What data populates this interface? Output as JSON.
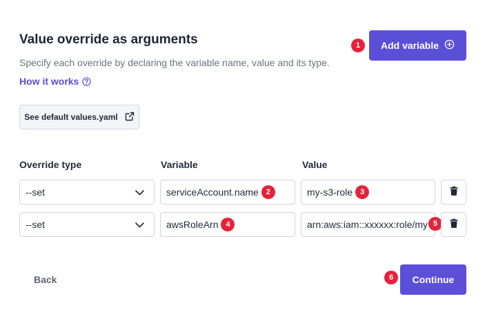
{
  "header": {
    "title": "Value override as arguments",
    "subtitle": "Specify each override by declaring the variable name, value and its type.",
    "how_it_works": "How it works"
  },
  "actions": {
    "add_variable": "Add variable",
    "see_default": "See default values.yaml",
    "back": "Back",
    "continue": "Continue"
  },
  "table": {
    "columns": [
      "Override type",
      "Variable",
      "Value"
    ],
    "rows": [
      {
        "type": "--set",
        "variable": "serviceAccount.name",
        "value": "my-s3-role"
      },
      {
        "type": "--set",
        "variable": "awsRoleArn",
        "value": "arn:aws:iam::xxxxxx:role/my"
      }
    ]
  },
  "badges": [
    "1",
    "2",
    "3",
    "4",
    "5",
    "6"
  ],
  "icons": {
    "help": "question-circle-icon",
    "add": "plus-circle-icon",
    "external": "external-link-icon",
    "chevron": "chevron-down-icon",
    "delete": "trash-icon"
  },
  "colors": {
    "primary": "#5b4fd8",
    "link": "#5a4bd1",
    "badge": "#e5223a",
    "title": "#1c2437",
    "muted": "#6b7280"
  }
}
